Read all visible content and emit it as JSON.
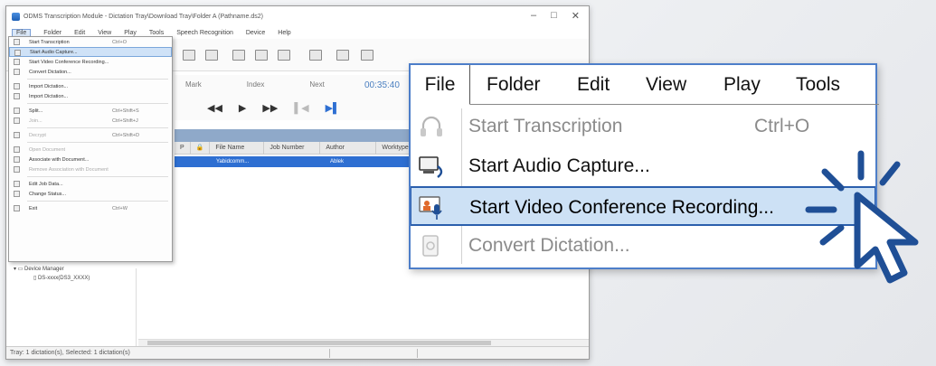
{
  "window": {
    "title": "ODMS Transcription Module - Dictation Tray\\Download Tray\\Folder A (Pathname.ds2)",
    "controls": [
      "–",
      "□",
      "✕"
    ]
  },
  "main_menu": [
    "File",
    "Folder",
    "Edit",
    "View",
    "Play",
    "Tools",
    "Speech Recognition",
    "Device",
    "Help"
  ],
  "mini_file_menu": [
    {
      "label": "Start Transcription",
      "shortcut": "Ctrl+O",
      "state": "normal"
    },
    {
      "label": "Start Audio Capture...",
      "shortcut": "",
      "state": "highlighted"
    },
    {
      "label": "Start Video Conference Recording...",
      "shortcut": "",
      "state": "normal"
    },
    {
      "label": "Convert Dictation...",
      "shortcut": "",
      "state": "normal"
    },
    {
      "sep": true
    },
    {
      "label": "Import Dictation...",
      "shortcut": "",
      "state": "normal"
    },
    {
      "label": "Import Dictation...",
      "shortcut": "",
      "state": "normal"
    },
    {
      "sep": true
    },
    {
      "label": "Split...",
      "shortcut": "Ctrl+Shift+S",
      "state": "normal"
    },
    {
      "label": "Join...",
      "shortcut": "Ctrl+Shift+J",
      "state": "dim"
    },
    {
      "sep": true
    },
    {
      "label": "Decrypt",
      "shortcut": "Ctrl+Shift+D",
      "state": "dim"
    },
    {
      "sep": true
    },
    {
      "label": "Open Document",
      "shortcut": "",
      "state": "dim"
    },
    {
      "label": "Associate with Document...",
      "shortcut": "",
      "state": "normal"
    },
    {
      "label": "Remove Association with Document",
      "shortcut": "",
      "state": "dim"
    },
    {
      "sep": true
    },
    {
      "label": "Edit Job Data...",
      "shortcut": "",
      "state": "normal"
    },
    {
      "label": "Change Status...",
      "shortcut": "",
      "state": "normal"
    },
    {
      "sep": true
    },
    {
      "label": "Exit",
      "shortcut": "Ctrl+W",
      "state": "normal"
    }
  ],
  "control_tabs": [
    "Mark",
    "Index",
    "Next"
  ],
  "timer": "00:35:40",
  "grid_headers": [
    "P",
    "File Name",
    "Job Number",
    "Author",
    "Worktype"
  ],
  "grid_row": [
    "Yabidcomm...",
    "",
    "Ablek"
  ],
  "tree": {
    "root": "Device Manager",
    "child": "DS-xxxx(DS3_XXXX)"
  },
  "statusbar": [
    "Tray: 1 dictation(s), Selected: 1 dictation(s)",
    "",
    ""
  ],
  "callout": {
    "menus": [
      "File",
      "Folder",
      "Edit",
      "View",
      "Play",
      "Tools"
    ],
    "items": [
      {
        "label": "Start Transcription",
        "shortcut": "Ctrl+O",
        "icon": "headphones-icon",
        "state": "disabled"
      },
      {
        "label": "Start Audio Capture...",
        "shortcut": "",
        "icon": "audio-capture-icon",
        "state": "enabled"
      },
      {
        "label": "Start Video Conference Recording...",
        "shortcut": "",
        "icon": "video-conference-icon",
        "state": "highlighted"
      },
      {
        "label": "Convert Dictation...",
        "shortcut": "",
        "icon": "convert-dictation-icon",
        "state": "disabled"
      }
    ]
  },
  "colors": {
    "accent": "#2b5fad",
    "highlight": "#cde1f5",
    "disabled_text": "#8b8b8b",
    "selection_row": "#2e6fd2"
  }
}
